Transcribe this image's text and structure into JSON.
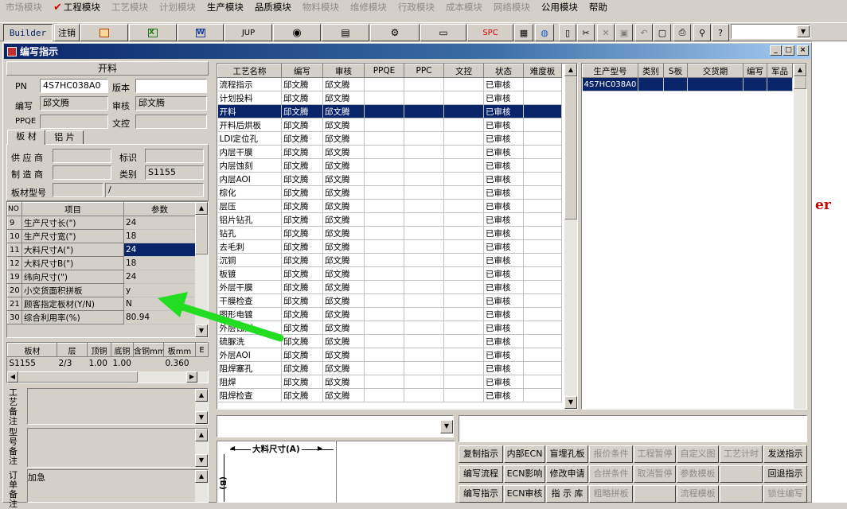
{
  "menu": [
    {
      "label": "市场模块",
      "enabled": false
    },
    {
      "label": "工程模块",
      "enabled": true,
      "checked": true
    },
    {
      "label": "工艺模块",
      "enabled": false
    },
    {
      "label": "计划模块",
      "enabled": false
    },
    {
      "label": "生产模块",
      "enabled": true
    },
    {
      "label": "品质模块",
      "enabled": true
    },
    {
      "label": "物料模块",
      "enabled": false
    },
    {
      "label": "维修模块",
      "enabled": false
    },
    {
      "label": "行政模块",
      "enabled": false
    },
    {
      "label": "成本模块",
      "enabled": false
    },
    {
      "label": "网络模块",
      "enabled": false
    },
    {
      "label": "公用模块",
      "enabled": true
    },
    {
      "label": "帮助",
      "enabled": true
    }
  ],
  "toolbar": {
    "builder_label": "Builder",
    "logout_label": "注销",
    "jup_label": "JUP",
    "spc_label": "SPC"
  },
  "window": {
    "title": "编写指示",
    "min": "_",
    "max": "□",
    "close": "×"
  },
  "left": {
    "header": "开料",
    "pn_label": "PN",
    "pn_value": "4S7HC038A0",
    "version_label": "版本",
    "version_value": "",
    "author_label": "编写",
    "author_value": "邱文腾",
    "reviewer_label": "审核",
    "reviewer_value": "邱文腾",
    "ppqe_label": "PPQE",
    "ppqe_value": "",
    "doc_label": "文控",
    "doc_value": "",
    "tabs": [
      "板 材",
      "铝 片"
    ],
    "supplier_label": "供 应 商",
    "supplier_value": "",
    "mark_label": "标识",
    "mark_value": "",
    "maker_label": "制 造 商",
    "maker_value": "",
    "category_label": "类别",
    "category_value": "S1155",
    "model_label": "板材型号",
    "model_value": "",
    "model_value2": "/",
    "params": {
      "headers": [
        "NO",
        "项目",
        "参数"
      ],
      "rows": [
        [
          "9",
          "生产尺寸长(\")",
          "24"
        ],
        [
          "10",
          "生产尺寸宽(\")",
          "18"
        ],
        [
          "11",
          "大料尺寸A(\")",
          "24"
        ],
        [
          "12",
          "大料尺寸B(\")",
          "18"
        ],
        [
          "19",
          "纬向尺寸(\")",
          "24"
        ],
        [
          "20",
          "小交货面积拼板",
          "y"
        ],
        [
          "21",
          "顾客指定板材(Y/N)",
          "N"
        ],
        [
          "30",
          "综合利用率(%)",
          "80.94"
        ]
      ],
      "selected_row": 2
    },
    "material": {
      "headers": [
        "板材",
        "层",
        "顶铜",
        "底铜",
        "含铜mm",
        "板mm",
        "E"
      ],
      "rows": [
        [
          "S1155",
          "2/3",
          "1.00",
          "1.00",
          "",
          "0.360",
          ""
        ]
      ]
    },
    "remark1_label": "工艺备注",
    "remark2_label": "型号备注",
    "remark3_label": "订单备注",
    "remark3_value": "加急"
  },
  "process": {
    "headers": [
      "工艺名称",
      "编写",
      "审核",
      "PPQE",
      "PPC",
      "文控",
      "状态",
      "难度板"
    ],
    "rows": [
      [
        "流程指示",
        "邱文腾",
        "邱文腾",
        "",
        "",
        "",
        "已审核",
        ""
      ],
      [
        "计划投料",
        "邱文腾",
        "邱文腾",
        "",
        "",
        "",
        "已审核",
        ""
      ],
      [
        "开料",
        "邱文腾",
        "邱文腾",
        "",
        "",
        "",
        "已审核",
        ""
      ],
      [
        "开料后烘板",
        "邱文腾",
        "邱文腾",
        "",
        "",
        "",
        "已审核",
        ""
      ],
      [
        "LDI定位孔",
        "邱文腾",
        "邱文腾",
        "",
        "",
        "",
        "已审核",
        ""
      ],
      [
        "内层干膜",
        "邱文腾",
        "邱文腾",
        "",
        "",
        "",
        "已审核",
        ""
      ],
      [
        "内层蚀刻",
        "邱文腾",
        "邱文腾",
        "",
        "",
        "",
        "已审核",
        ""
      ],
      [
        "内层AOI",
        "邱文腾",
        "邱文腾",
        "",
        "",
        "",
        "已审核",
        ""
      ],
      [
        "棕化",
        "邱文腾",
        "邱文腾",
        "",
        "",
        "",
        "已审核",
        ""
      ],
      [
        "层压",
        "邱文腾",
        "邱文腾",
        "",
        "",
        "",
        "已审核",
        ""
      ],
      [
        "铝片钻孔",
        "邱文腾",
        "邱文腾",
        "",
        "",
        "",
        "已审核",
        ""
      ],
      [
        "钻孔",
        "邱文腾",
        "邱文腾",
        "",
        "",
        "",
        "已审核",
        ""
      ],
      [
        "去毛刺",
        "邱文腾",
        "邱文腾",
        "",
        "",
        "",
        "已审核",
        ""
      ],
      [
        "沉铜",
        "邱文腾",
        "邱文腾",
        "",
        "",
        "",
        "已审核",
        ""
      ],
      [
        "板镀",
        "邱文腾",
        "邱文腾",
        "",
        "",
        "",
        "已审核",
        ""
      ],
      [
        "外层干膜",
        "邱文腾",
        "邱文腾",
        "",
        "",
        "",
        "已审核",
        ""
      ],
      [
        "干膜检查",
        "邱文腾",
        "邱文腾",
        "",
        "",
        "",
        "已审核",
        ""
      ],
      [
        "图形电镀",
        "邱文腾",
        "邱文腾",
        "",
        "",
        "",
        "已审核",
        ""
      ],
      [
        "外层蚀刻",
        "邱文腾",
        "邱文腾",
        "",
        "",
        "",
        "已审核",
        ""
      ],
      [
        "硫脲洗",
        "邱文腾",
        "邱文腾",
        "",
        "",
        "",
        "已审核",
        ""
      ],
      [
        "外层AOI",
        "邱文腾",
        "邱文腾",
        "",
        "",
        "",
        "已审核",
        ""
      ],
      [
        "阻焊塞孔",
        "邱文腾",
        "邱文腾",
        "",
        "",
        "",
        "已审核",
        ""
      ],
      [
        "阻焊",
        "邱文腾",
        "邱文腾",
        "",
        "",
        "",
        "已审核",
        ""
      ],
      [
        "阻焊检查",
        "邱文腾",
        "邱文腾",
        "",
        "",
        "",
        "已审核",
        ""
      ]
    ],
    "selected_row": 2
  },
  "products": {
    "headers": [
      "生产型号",
      "类别",
      "S板",
      "交货期",
      "编写",
      "军品"
    ],
    "rows": [
      [
        "4S7HC038A0",
        "",
        "",
        "",
        "",
        ""
      ]
    ]
  },
  "dim_label": "大料尺寸(A)",
  "dim_label_b": "(B)",
  "actions": [
    [
      {
        "label": "复制指示",
        "enabled": true
      },
      {
        "label": "内部ECN",
        "enabled": true
      },
      {
        "label": "盲埋孔板",
        "enabled": true
      },
      {
        "label": "报价条件",
        "enabled": false
      },
      {
        "label": "工程暂停",
        "enabled": false
      },
      {
        "label": "自定义图",
        "enabled": false
      },
      {
        "label": "工艺计时",
        "enabled": false
      },
      {
        "label": "发送指示",
        "enabled": true
      }
    ],
    [
      {
        "label": "编写流程",
        "enabled": true
      },
      {
        "label": "ECN影响",
        "enabled": true
      },
      {
        "label": "修改申请",
        "enabled": true
      },
      {
        "label": "合拼条件",
        "enabled": false
      },
      {
        "label": "取消暂停",
        "enabled": false
      },
      {
        "label": "参数模板",
        "enabled": false
      },
      {
        "label": "",
        "enabled": false
      },
      {
        "label": "回退指示",
        "enabled": true
      }
    ],
    [
      {
        "label": "编写指示",
        "enabled": true
      },
      {
        "label": "ECN审核",
        "enabled": true
      },
      {
        "label": "指 示 库",
        "enabled": true
      },
      {
        "label": "粗略拼板",
        "enabled": false
      },
      {
        "label": "",
        "enabled": false
      },
      {
        "label": "流程模板",
        "enabled": false
      },
      {
        "label": "",
        "enabled": false
      },
      {
        "label": "锁住编写",
        "enabled": false
      }
    ]
  ],
  "colors": {
    "selection": "#0a246a",
    "arrow": "#22dd22",
    "background": "#d4d0c8"
  }
}
